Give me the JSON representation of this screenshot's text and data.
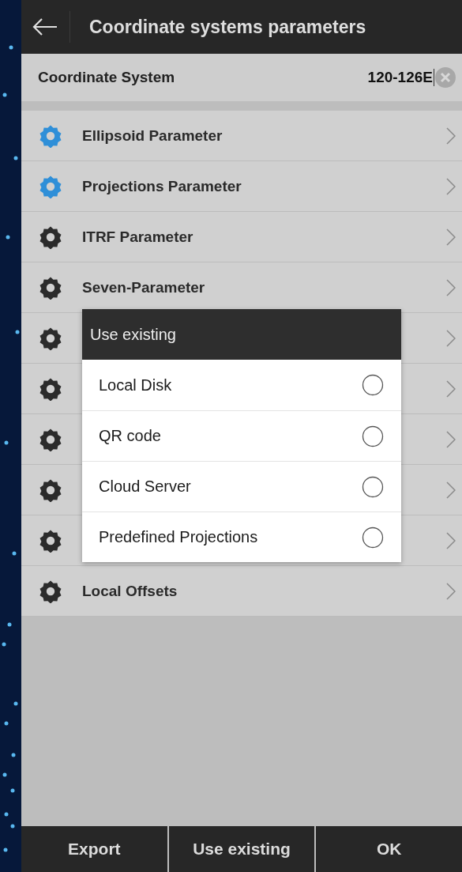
{
  "header": {
    "title": "Coordinate systems parameters"
  },
  "coordinate_system": {
    "label": "Coordinate System",
    "value": "120-126E"
  },
  "parameters": [
    {
      "label": "Ellipsoid Parameter",
      "active": true
    },
    {
      "label": "Projections Parameter",
      "active": true
    },
    {
      "label": "ITRF Parameter",
      "active": false
    },
    {
      "label": "Seven-Parameter",
      "active": false
    },
    {
      "active": false
    },
    {
      "active": false
    },
    {
      "active": false
    },
    {
      "active": false
    },
    {
      "active": false
    },
    {
      "label": "Local Offsets",
      "active": false
    }
  ],
  "dialog": {
    "title": "Use existing",
    "options": [
      {
        "label": "Local Disk",
        "selected": false
      },
      {
        "label": "QR code",
        "selected": false
      },
      {
        "label": "Cloud Server",
        "selected": false
      },
      {
        "label": "Predefined Projections",
        "selected": false
      }
    ]
  },
  "bottom_buttons": [
    "Export",
    "Use existing",
    "OK"
  ]
}
